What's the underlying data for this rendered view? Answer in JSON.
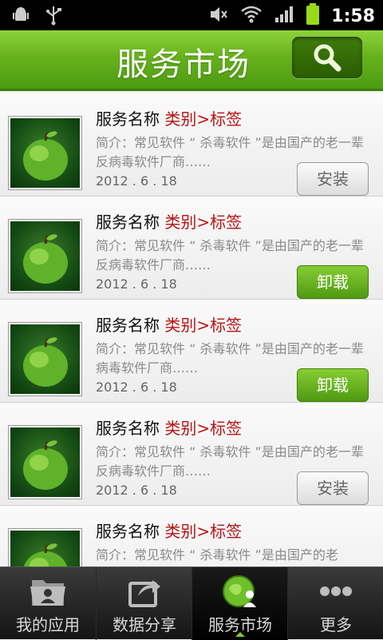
{
  "status_bar": {
    "time": "1:58"
  },
  "header": {
    "title": "服务市场"
  },
  "items": [
    {
      "name": "服务名称",
      "category": "类别",
      "arrow": ">",
      "tag": "标签",
      "desc": "简介：常见软件 “ 杀毒软件 ”是由国产的老一辈反病毒软件厂商……",
      "date": "2012 . 6 . 18",
      "button": "安装",
      "button_state": "install"
    },
    {
      "name": "服务名称",
      "category": "类别",
      "arrow": ">",
      "tag": "标签",
      "desc": "简介：常见软件 “ 杀毒软件 ”是由国产的老一辈反病毒软件厂商……",
      "date": "2012 . 6 . 18",
      "button": "卸载",
      "button_state": "uninstall"
    },
    {
      "name": "服务名称",
      "category": "类别",
      "arrow": ">",
      "tag": "标签",
      "desc": "简介：常见软件 “ 杀毒软件 ”是由国产的老一辈病毒软件厂商……",
      "date": "2012 . 6 . 18",
      "button": "卸载",
      "button_state": "uninstall"
    },
    {
      "name": "服务名称",
      "category": "类别",
      "arrow": ">",
      "tag": "标签",
      "desc": "简介：常见软件 “ 杀毒软件 ”是由国产的老一辈反病毒软件厂商……",
      "date": "2012 . 6 . 18",
      "button": "安装",
      "button_state": "install"
    },
    {
      "name": "服务名称",
      "category": "类别",
      "arrow": ">",
      "tag": "标签",
      "desc": "简介：常见软件 “ 杀毒软件 ”是由国产的老",
      "date": "",
      "button": "",
      "button_state": "none"
    }
  ],
  "tabs": [
    {
      "label": "我的应用",
      "icon": "folder-user-icon"
    },
    {
      "label": "数据分享",
      "icon": "share-icon"
    },
    {
      "label": "服务市场",
      "icon": "service-market-icon",
      "active": true
    },
    {
      "label": "更多",
      "icon": "more-dots-icon"
    }
  ],
  "colors": {
    "accent": "#66b21d",
    "tag_red": "#b71414",
    "uninstall_green": "#5aa51a"
  }
}
